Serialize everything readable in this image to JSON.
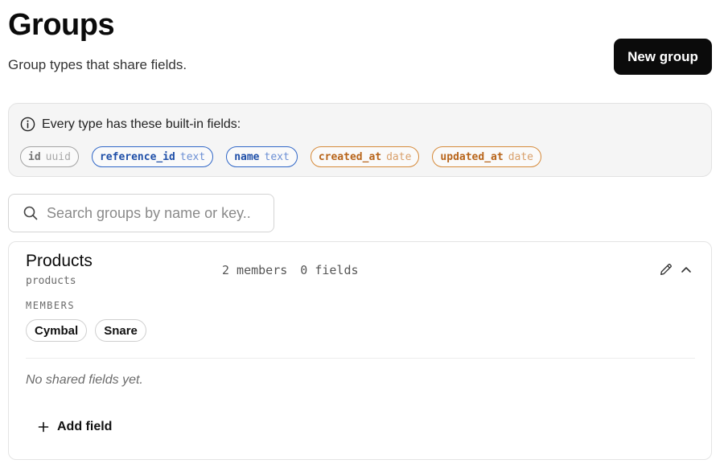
{
  "header": {
    "title": "Groups",
    "subtitle": "Group types that share fields.",
    "new_group_label": "New group"
  },
  "builtin": {
    "title": "Every type has these built-in fields:",
    "icon": "info-icon",
    "fields": [
      {
        "name": "id",
        "type": "uuid"
      },
      {
        "name": "reference_id",
        "type": "text"
      },
      {
        "name": "name",
        "type": "text"
      },
      {
        "name": "created_at",
        "type": "date"
      },
      {
        "name": "updated_at",
        "type": "date"
      }
    ]
  },
  "search": {
    "placeholder": "Search groups by name or key..",
    "value": "",
    "icon": "search-icon"
  },
  "groups": [
    {
      "name": "Products",
      "key": "products",
      "members_count": "2 members",
      "fields_count": "0 fields",
      "members_label": "MEMBERS",
      "members": [
        "Cymbal",
        "Snare"
      ],
      "empty_fields_text": "No shared fields yet.",
      "add_field_label": "Add field"
    }
  ],
  "colors": {
    "primary_button": "#0b0b0b",
    "chip_gray": "#a3a3a3",
    "chip_blue": "#2f66c7",
    "chip_orange": "#d68a3a"
  }
}
